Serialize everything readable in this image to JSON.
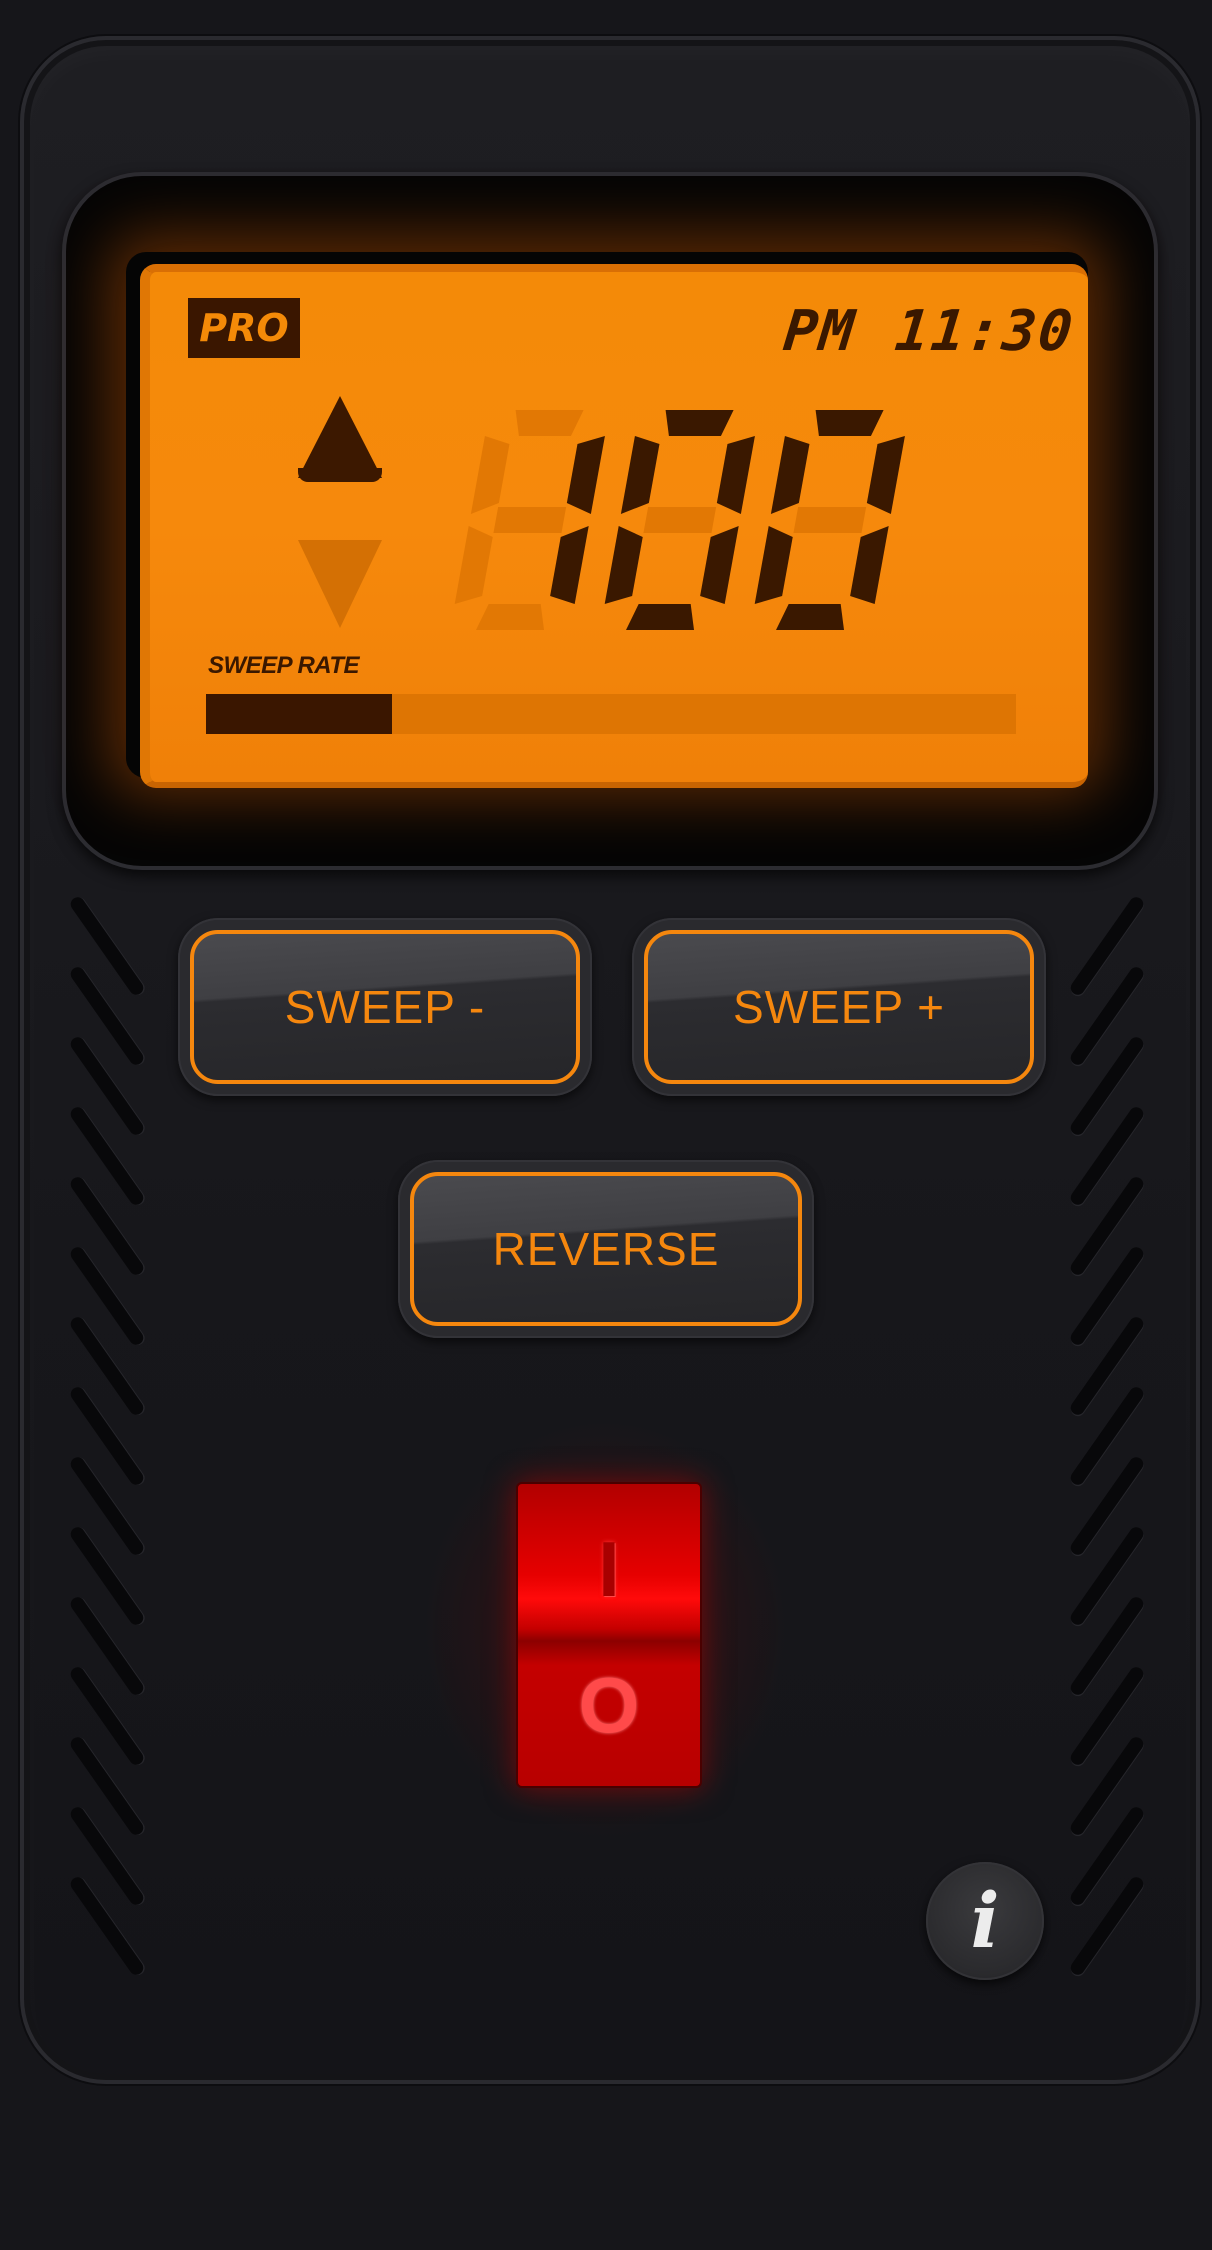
{
  "display": {
    "badge": "PRO",
    "clock": {
      "ampm": "PM",
      "hour": "11",
      "separator": ":",
      "minute": "30"
    },
    "reading": "100",
    "direction": "up",
    "sweep_rate_label": "SWEEP RATE",
    "sweep_rate_level": 0.23
  },
  "controls": {
    "sweep_minus_label": "SWEEP -",
    "sweep_plus_label": "SWEEP +",
    "reverse_label": "REVERSE"
  },
  "power_switch": {
    "on_label": "I",
    "off_label": "O",
    "state": "on"
  },
  "info_button": {
    "icon": "info-icon",
    "glyph": "i"
  },
  "colors": {
    "lcd": "#f48a08",
    "lcd_ink": "#3a1800",
    "button_accent": "#f5870e",
    "power_red": "#e60000"
  }
}
